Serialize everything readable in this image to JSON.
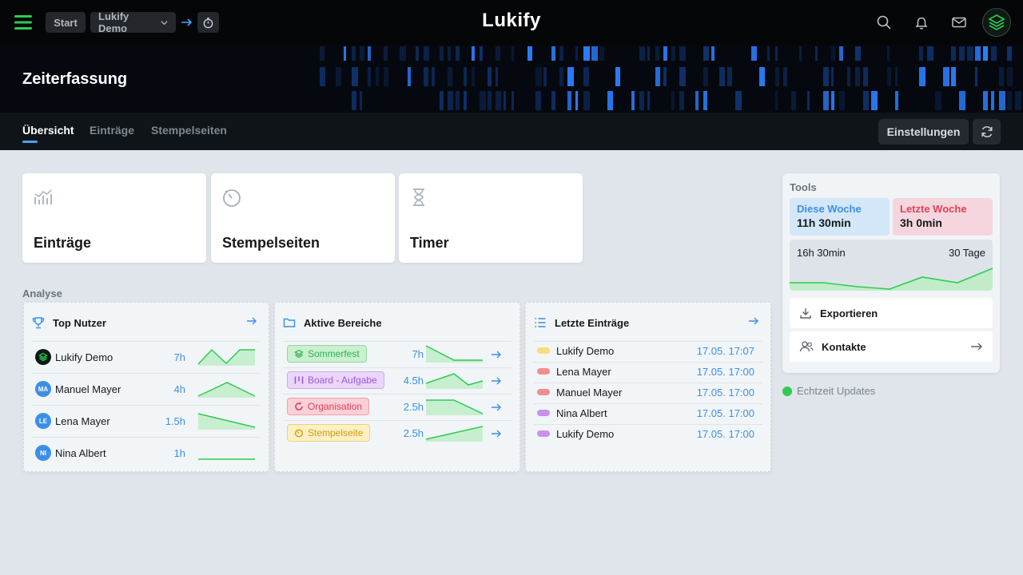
{
  "app": {
    "brand": "Lukify"
  },
  "topbar": {
    "breadcrumb_start": "Start",
    "breadcrumb_workspace": "Lukify Demo"
  },
  "hero": {
    "title": "Zeiterfassung"
  },
  "tabs": [
    {
      "label": "Übersicht",
      "active": true
    },
    {
      "label": "Einträge",
      "active": false
    },
    {
      "label": "Stempelseiten",
      "active": false
    }
  ],
  "actions": {
    "settings_label": "Einstellungen"
  },
  "cards": [
    {
      "label": "Einträge",
      "icon": "chart-icon"
    },
    {
      "label": "Stempelseiten",
      "icon": "stopwatch-icon"
    },
    {
      "label": "Timer",
      "icon": "hourglass-icon"
    }
  ],
  "analysis": {
    "label": "Analyse",
    "top_users": {
      "title": "Top Nutzer",
      "rows": [
        {
          "initials": "",
          "name": "Lukify Demo",
          "value": "7h"
        },
        {
          "initials": "MA",
          "name": "Manuel Mayer",
          "value": "4h"
        },
        {
          "initials": "LE",
          "name": "Lena Mayer",
          "value": "1.5h"
        },
        {
          "initials": "NI",
          "name": "Nina Albert",
          "value": "1h"
        }
      ]
    },
    "active_areas": {
      "title": "Aktive Bereiche",
      "rows": [
        {
          "label": "Sommerfest",
          "value": "7h",
          "color": "#2fae57"
        },
        {
          "label": "Board - Aufgabe",
          "value": "4.5h",
          "color": "#9b59d6"
        },
        {
          "label": "Organisation",
          "value": "2.5h",
          "color": "#e0405a"
        },
        {
          "label": "Stempelseite",
          "value": "2.5h",
          "color": "#d49a12"
        }
      ]
    },
    "last_entries": {
      "title": "Letzte Einträge",
      "rows": [
        {
          "name": "Lukify Demo",
          "date": "17.05. 17:07",
          "color": "#f3df7a"
        },
        {
          "name": "Lena Mayer",
          "date": "17.05. 17:00",
          "color": "#ee8f8f"
        },
        {
          "name": "Manuel Mayer",
          "date": "17.05. 17:00",
          "color": "#ee8f8f"
        },
        {
          "name": "Nina Albert",
          "date": "17.05. 17:00",
          "color": "#c592ec"
        },
        {
          "name": "Lukify Demo",
          "date": "17.05. 17:00",
          "color": "#c592ec"
        }
      ]
    }
  },
  "tools": {
    "title": "Tools",
    "this_week": {
      "label": "Diese Woche",
      "value": "11h 30min"
    },
    "last_week": {
      "label": "Letzte Woche",
      "value": "3h 0min"
    },
    "summary": {
      "total": "16h 30min",
      "days": "30 Tage"
    },
    "export_label": "Exportieren",
    "contacts_label": "Kontakte"
  },
  "realtime": {
    "label": "Echtzeit Updates"
  },
  "colors": {
    "accent": "#3b8fe8",
    "success": "#2ecc52",
    "dark": "#050607"
  }
}
